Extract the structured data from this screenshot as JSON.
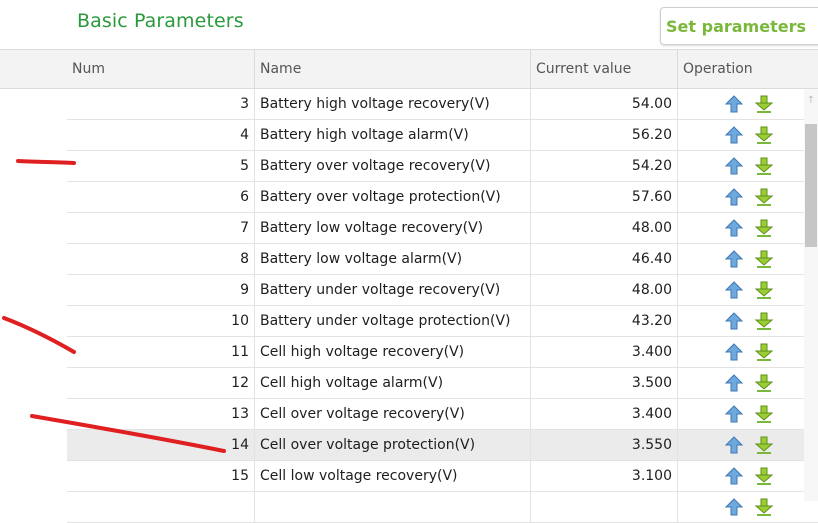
{
  "title": "Basic Parameters",
  "set_button_label": "Set parameters",
  "columns": {
    "num": "Num",
    "name": "Name",
    "value": "Current value",
    "operation": "Operation"
  },
  "rows": [
    {
      "num": "3",
      "name": "Battery high voltage recovery(V)",
      "value": "54.00"
    },
    {
      "num": "4",
      "name": "Battery high voltage alarm(V)",
      "value": "56.20"
    },
    {
      "num": "5",
      "name": "Battery over voltage recovery(V)",
      "value": "54.20"
    },
    {
      "num": "6",
      "name": "Battery over voltage protection(V)",
      "value": "57.60"
    },
    {
      "num": "7",
      "name": "Battery low voltage recovery(V)",
      "value": "48.00"
    },
    {
      "num": "8",
      "name": "Battery low voltage alarm(V)",
      "value": "46.40"
    },
    {
      "num": "9",
      "name": "Battery under voltage recovery(V)",
      "value": "48.00"
    },
    {
      "num": "10",
      "name": "Battery under voltage protection(V)",
      "value": "43.20"
    },
    {
      "num": "11",
      "name": "Cell high voltage recovery(V)",
      "value": "3.400"
    },
    {
      "num": "12",
      "name": "Cell high voltage alarm(V)",
      "value": "3.500"
    },
    {
      "num": "13",
      "name": "Cell over voltage recovery(V)",
      "value": "3.400"
    },
    {
      "num": "14",
      "name": "Cell over voltage protection(V)",
      "value": "3.550"
    },
    {
      "num": "15",
      "name": "Cell low voltage recovery(V)",
      "value": "3.100"
    },
    {
      "num": "",
      "name": "",
      "value": ""
    }
  ],
  "selected_row_num": "14",
  "icons": {
    "read": "upload-arrow-icon",
    "write": "download-arrow-icon",
    "scroll_up": "scroll-up-icon"
  },
  "colors": {
    "title": "#2a9a3c",
    "button_text": "#7ab83b",
    "up_arrow": "#5b9bd5",
    "down_arrow": "#8cc63f",
    "annotation": "#e02020"
  }
}
